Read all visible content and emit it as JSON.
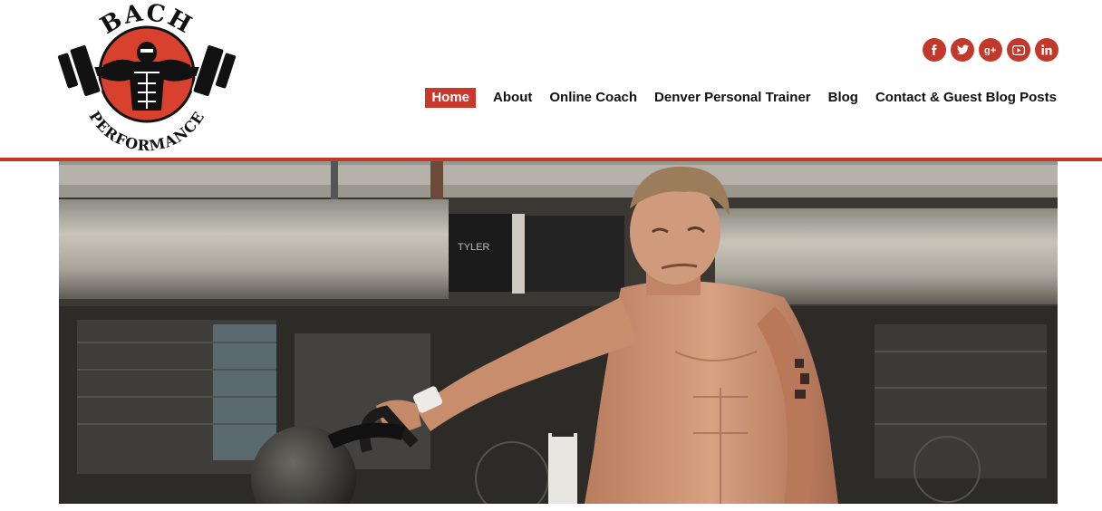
{
  "brand": {
    "logo_top": "BACH",
    "logo_bottom": "PERFORMANCE",
    "accent_color": "#c0392b"
  },
  "social": [
    {
      "name": "facebook",
      "glyph": "f"
    },
    {
      "name": "twitter",
      "glyph": "t"
    },
    {
      "name": "google-plus",
      "glyph": "g+"
    },
    {
      "name": "youtube",
      "glyph": "yt"
    },
    {
      "name": "linkedin",
      "glyph": "in"
    }
  ],
  "nav": {
    "items": [
      {
        "label": "Home",
        "active": true
      },
      {
        "label": "About",
        "active": false
      },
      {
        "label": "Online Coach",
        "active": false
      },
      {
        "label": "Denver Personal Trainer",
        "active": false
      },
      {
        "label": "Blog",
        "active": false
      },
      {
        "label": "Contact & Guest Blog Posts",
        "active": false
      }
    ]
  },
  "hero": {
    "image_text": "TYLER"
  }
}
